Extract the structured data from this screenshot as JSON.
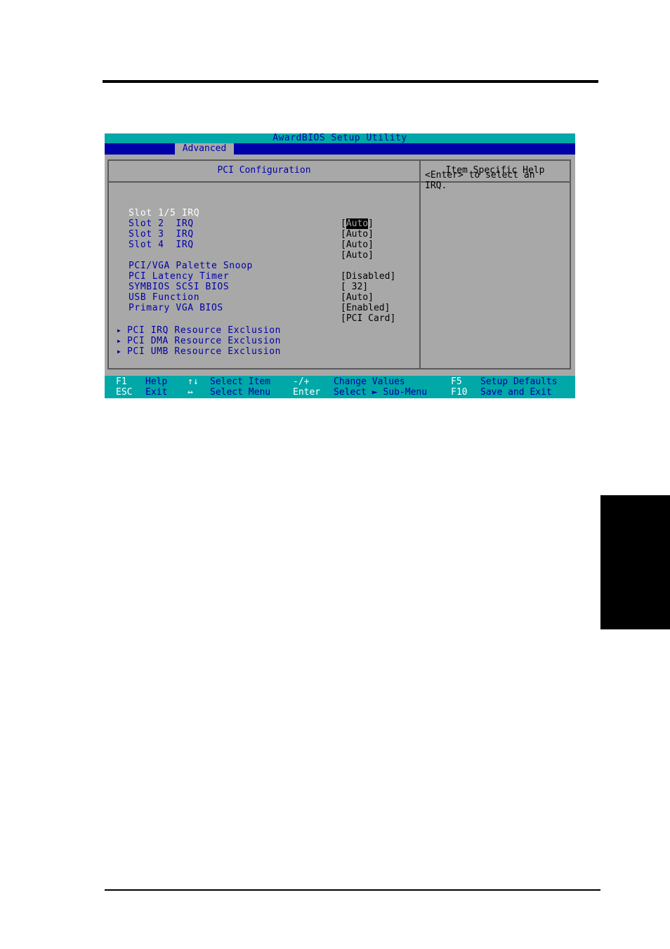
{
  "bios": {
    "title": "AwardBIOS Setup Utility",
    "active_menu": "Advanced",
    "colors": {
      "title_bar": "#00a8a8",
      "menu_bar": "#0000a8",
      "body": "#a8a8a8",
      "item_text": "#0000a8",
      "selected_text": "#ffffff"
    },
    "left_panel": {
      "title": "PCI Configuration",
      "items": [
        {
          "label": "Slot 1/5 IRQ",
          "value": "Auto",
          "selected": true
        },
        {
          "label": "Slot 2  IRQ",
          "value": "[Auto]"
        },
        {
          "label": "Slot 3  IRQ",
          "value": "[Auto]"
        },
        {
          "label": "Slot 4  IRQ",
          "value": "[Auto]"
        },
        {
          "label": "PCI/VGA Palette Snoop",
          "value": "[Disabled]"
        },
        {
          "label": "PCI Latency Timer",
          "value": "[ 32]"
        },
        {
          "label": "SYMBIOS SCSI BIOS",
          "value": "[Auto]"
        },
        {
          "label": "USB Function",
          "value": "[Enabled]"
        },
        {
          "label": "Primary VGA BIOS",
          "value": "[PCI Card]"
        }
      ],
      "submenus": [
        {
          "label": "PCI IRQ Resource Exclusion",
          "icon": "submenu-arrow-icon"
        },
        {
          "label": "PCI DMA Resource Exclusion",
          "icon": "submenu-arrow-icon"
        },
        {
          "label": "PCI UMB Resource Exclusion",
          "icon": "submenu-arrow-icon"
        }
      ]
    },
    "right_panel": {
      "title": "Item Specific Help",
      "help": "<Enter> to select an\nIRQ."
    },
    "status_bar": {
      "row1": [
        {
          "key": "F1",
          "action": "Help"
        },
        {
          "key": "↑↓",
          "action": "Select Item"
        },
        {
          "key": "-/+",
          "action": "Change Values"
        },
        {
          "key": "F5",
          "action": "Setup Defaults"
        }
      ],
      "row2": [
        {
          "key": "ESC",
          "action": "Exit"
        },
        {
          "key": "↔",
          "action": "Select Menu"
        },
        {
          "key": "Enter",
          "action": "Select ► Sub-Menu"
        },
        {
          "key": "F10",
          "action": "Save and Exit"
        }
      ]
    }
  }
}
